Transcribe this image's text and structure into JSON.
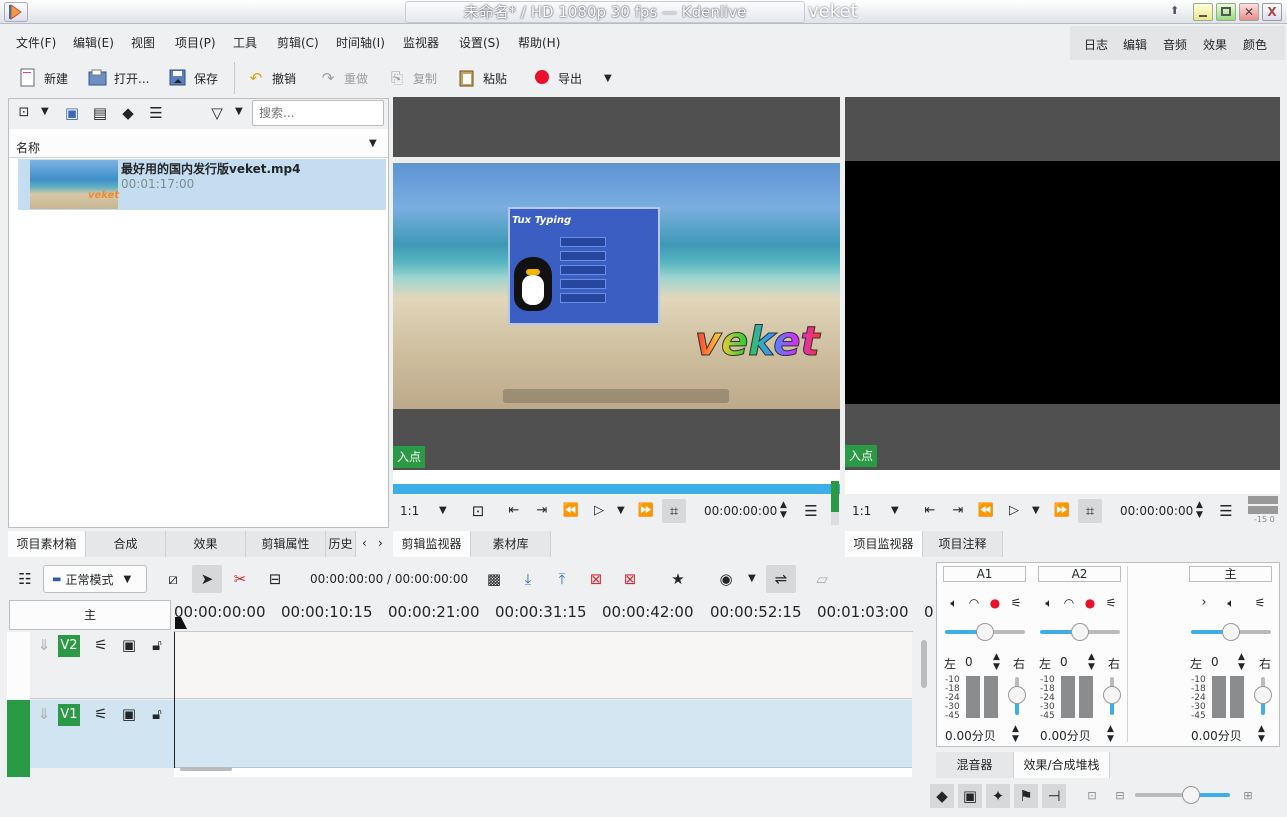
{
  "window": {
    "title": "未命名* / HD 1080p 30 fps — Kdenlive",
    "title_right": "veket"
  },
  "menu": [
    "文件(F)",
    "编辑(E)",
    "视图",
    "项目(P)",
    "工具",
    "剪辑(C)",
    "时间轴(I)",
    "监视器",
    "设置(S)",
    "帮助(H)"
  ],
  "layouts": [
    "日志",
    "编辑",
    "音频",
    "效果",
    "颜色"
  ],
  "toolbar": {
    "new": "新建",
    "open": "打开...",
    "save": "保存",
    "undo": "撤销",
    "redo": "重做",
    "copy": "复制",
    "paste": "粘贴",
    "render": "导出"
  },
  "bin": {
    "search_placeholder": "搜索...",
    "column_name": "名称",
    "clip_name": "最好用的国内发行版veket.mp4",
    "clip_duration": "00:01:17:00",
    "tabs": [
      "项目素材箱",
      "合成",
      "效果",
      "剪辑属性",
      "历史"
    ]
  },
  "clip_monitor": {
    "in_point": "入点",
    "zoom": "1:1",
    "timecode": "00:00:00:00",
    "tabs": [
      "剪辑监视器",
      "素材库"
    ],
    "veket_logo": "veket",
    "app_window_title": "Tux Typing"
  },
  "project_monitor": {
    "in_point": "入点",
    "zoom": "1:1",
    "timecode": "00:00:00:00",
    "level": "-15 0",
    "tabs": [
      "项目监视器",
      "项目注释"
    ]
  },
  "timeline": {
    "mode": "正常模式",
    "position": "00:00:00:00 / 00:00:00:00",
    "master_label": "主",
    "ruler": [
      "00:00:00:00",
      "00:00:10:15",
      "00:00:21:00",
      "00:00:31:15",
      "00:00:42:00",
      "00:00:52:15",
      "00:01:03:00",
      "0"
    ],
    "tracks": [
      "V2",
      "V1"
    ]
  },
  "mixer": {
    "channels": [
      {
        "name": "A1",
        "left": "左",
        "right": "右",
        "pan": "0",
        "gain": "0.00分贝"
      },
      {
        "name": "A2",
        "left": "左",
        "right": "右",
        "pan": "0",
        "gain": "0.00分贝"
      },
      {
        "name": "主",
        "left": "左",
        "right": "右",
        "pan": "0",
        "gain": "0.00分贝"
      }
    ],
    "scale": [
      "-10",
      "-18",
      "-24",
      "-30",
      "-45"
    ],
    "tabs": [
      "混音器",
      "效果/合成堆栈"
    ]
  }
}
